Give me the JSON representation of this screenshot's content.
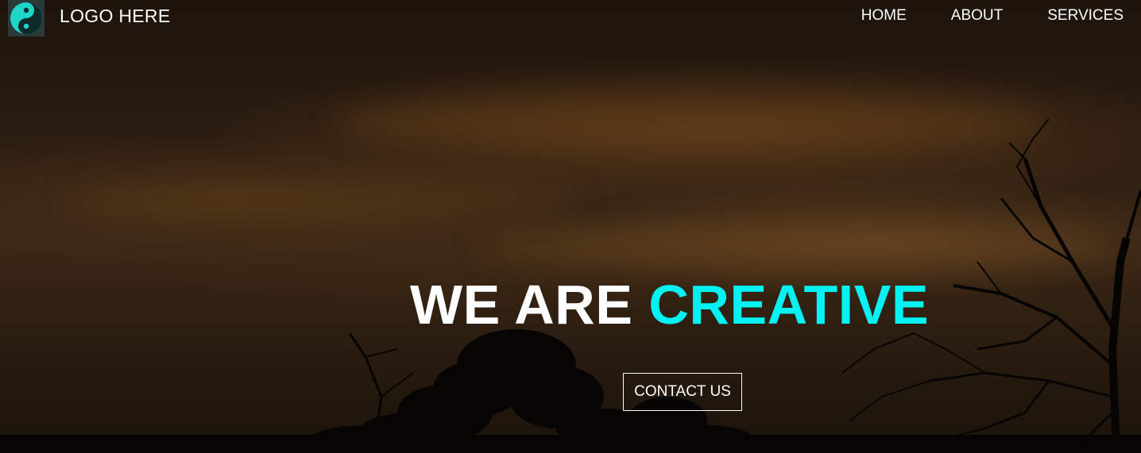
{
  "brand": {
    "logo_text": "LOGO HERE",
    "logo_icon": "yin-yang-icon",
    "accent_color": "#00f2f2"
  },
  "nav": {
    "items": [
      {
        "label": "HOME"
      },
      {
        "label": "ABOUT"
      },
      {
        "label": "SERVICES"
      }
    ]
  },
  "hero": {
    "headline_prefix": "WE ARE",
    "headline_accent": "CREATIVE",
    "cta_label": "CONTACT US",
    "background": "sunset-sky-with-tree-silhouettes"
  }
}
